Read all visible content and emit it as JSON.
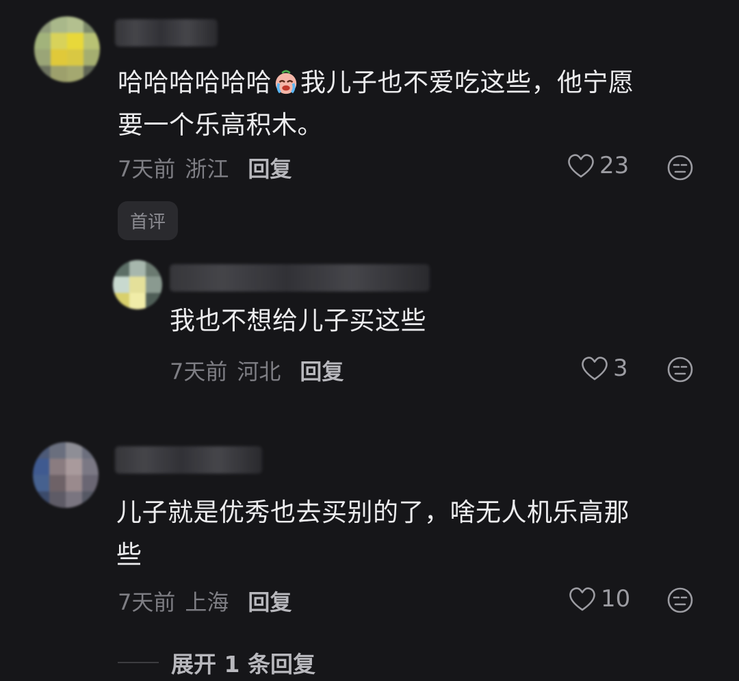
{
  "comments": [
    {
      "text_line1": "哈哈哈哈哈哈",
      "text_after_emoji": "我儿子也不爱吃这些，他宁愿",
      "text_line2": "要一个乐高积木。",
      "time": "7天前",
      "location": "浙江",
      "reply_label": "回复",
      "likes": "23",
      "badge": "首评",
      "emoji": "loudly-crying-face-emoji"
    },
    {
      "text_line1": "我也不想给儿子买这些",
      "time": "7天前",
      "location": "河北",
      "reply_label": "回复",
      "likes": "3"
    },
    {
      "text_line1": "儿子就是优秀也去买别的了，啥无人机乐高那",
      "text_line2": "些",
      "time": "7天前",
      "location": "上海",
      "reply_label": "回复",
      "likes": "10"
    }
  ],
  "expand_replies_label": "展开 1 条回复",
  "colors": {
    "background": "#161619",
    "text": "#ececee",
    "meta": "#7e7e84",
    "icon": "#9c9ca2"
  },
  "icons": [
    "heart-icon",
    "dislike-face-icon"
  ]
}
